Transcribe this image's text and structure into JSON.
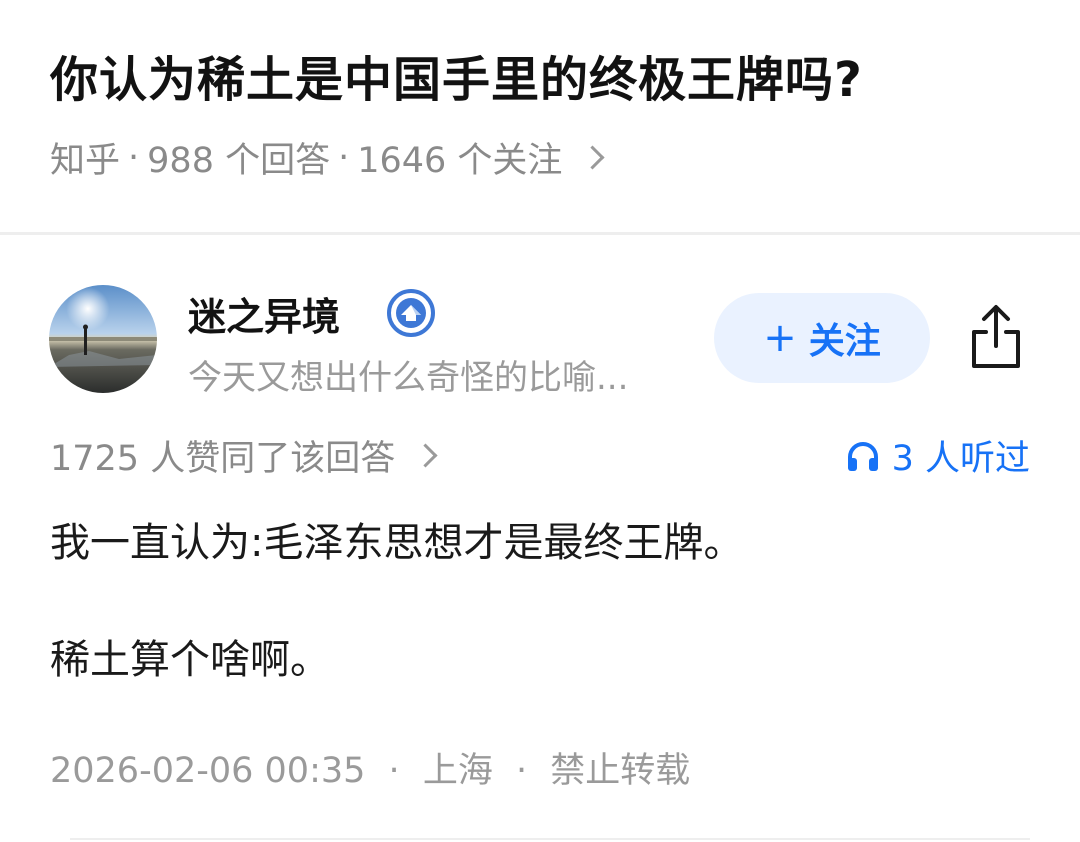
{
  "question": {
    "title": "你认为稀土是中国手里的终极王牌吗?",
    "site": "知乎",
    "answer_count": "988 个回答",
    "follow_count": "1646 个关注"
  },
  "author": {
    "name": "迷之异境",
    "bio": "今天又想出什么奇怪的比喻...",
    "follow_label": "关注",
    "follow_plus": "+"
  },
  "answer": {
    "votes": "1725 人赞同了该回答",
    "listeners": "3 人听过",
    "paragraphs": [
      "我一直认为:毛泽东思想才是最终王牌。",
      "稀土算个啥啊。"
    ],
    "date": "2026-02-06 00:35",
    "location": "上海",
    "copyright": "禁止转载"
  },
  "icons": {
    "badge": "verified-badge-icon",
    "share": "share-icon",
    "headphones": "headphones-icon",
    "chevron": "chevron-right-icon"
  },
  "colors": {
    "accent": "#1772f6",
    "follow_bg": "#eaf2ff",
    "meta_text": "#8a8a8a"
  }
}
